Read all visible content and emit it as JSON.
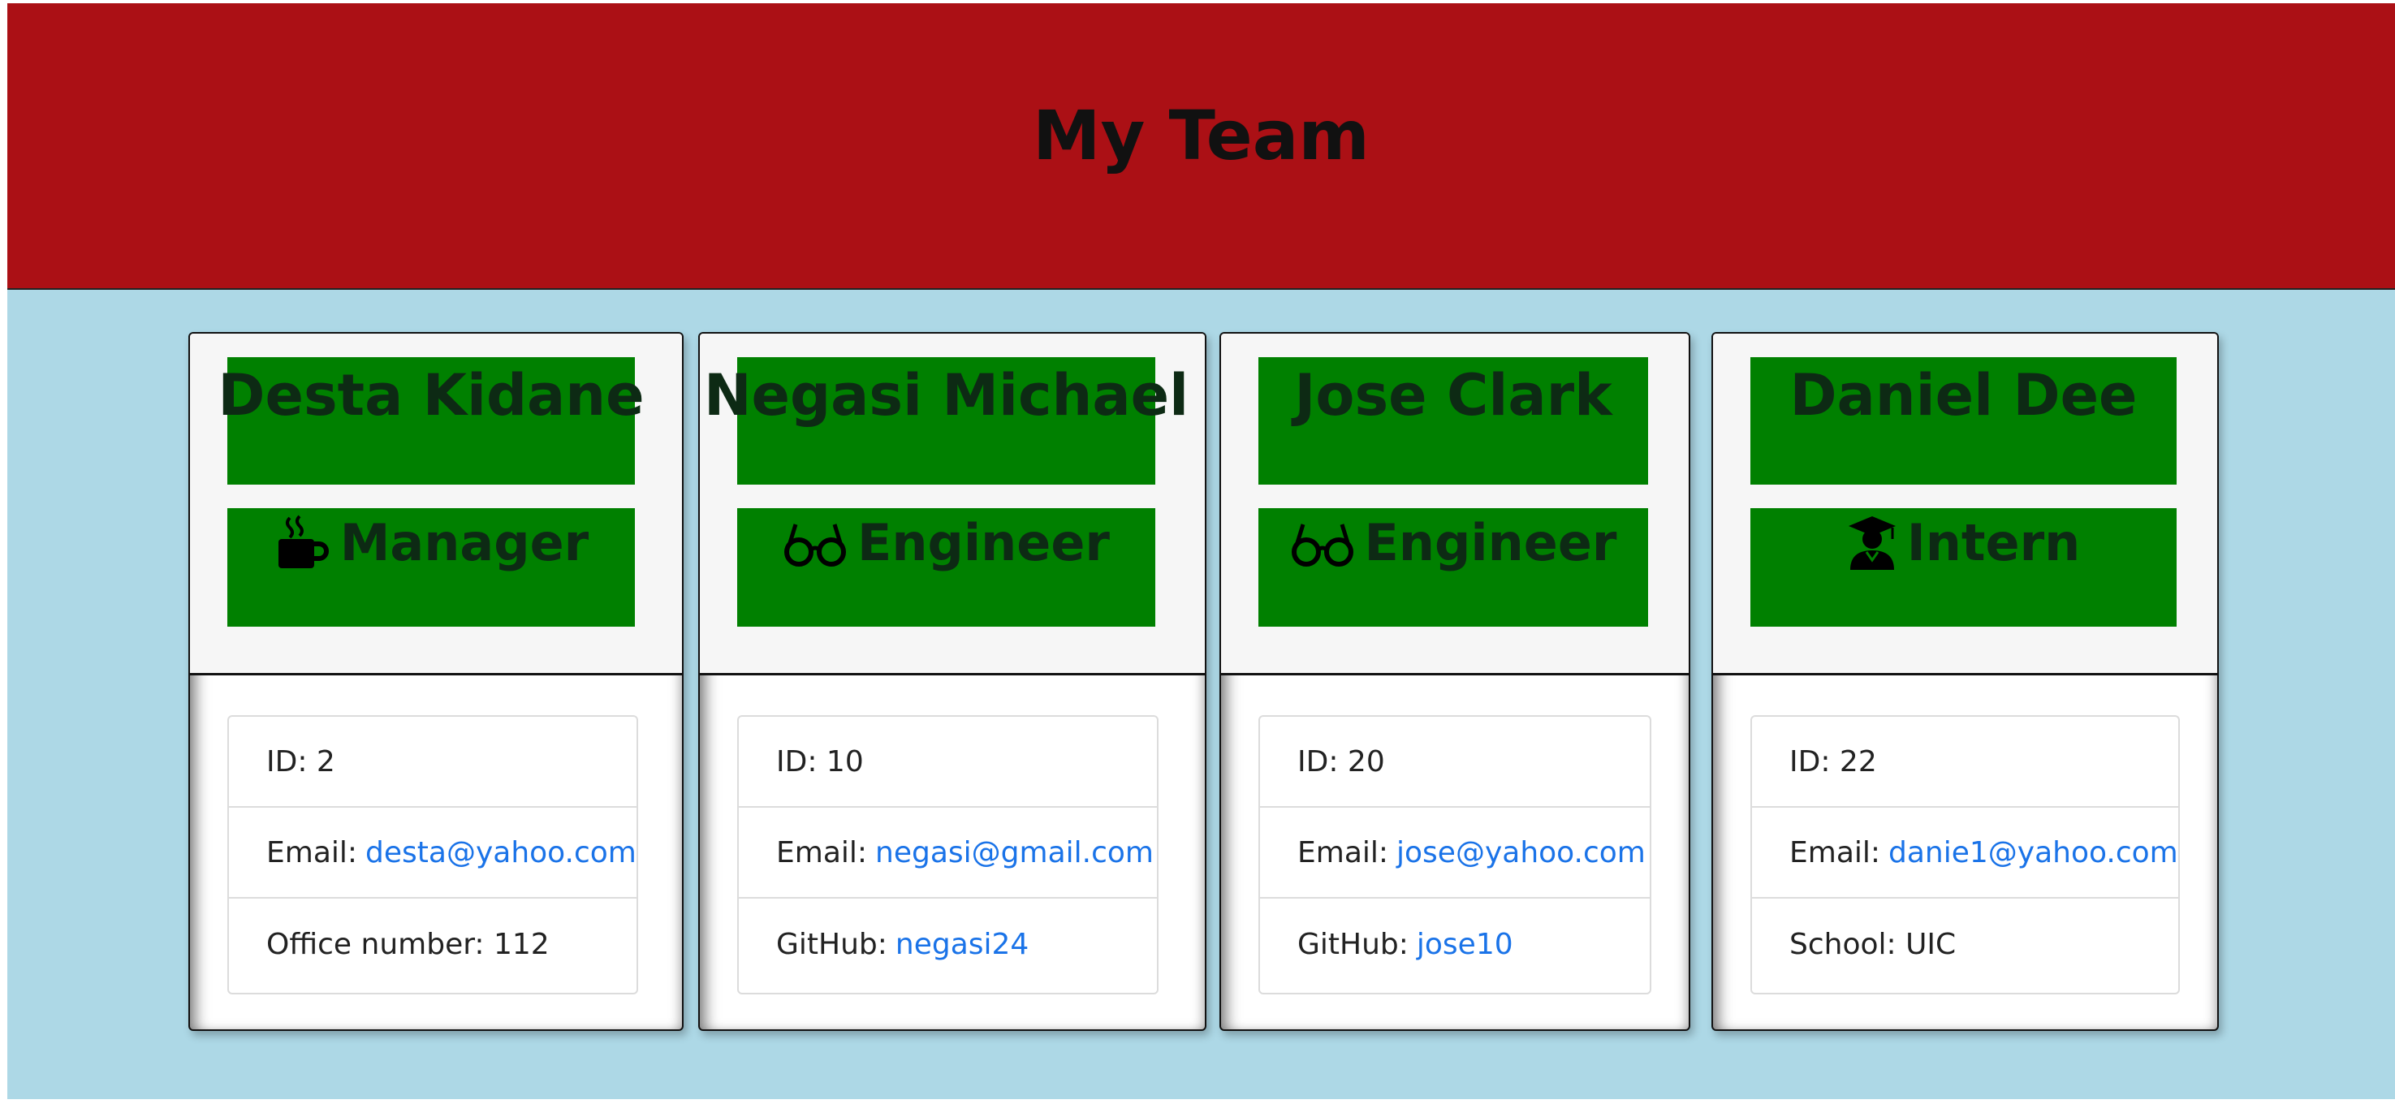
{
  "header": {
    "title": "My Team"
  },
  "colors": {
    "header_bg": "#ab1015",
    "page_bg": "#add8e6",
    "card_header_bg": "#008000",
    "link": "#1a73e8"
  },
  "cards": [
    {
      "name": "Desta Kidane",
      "role": "Manager",
      "role_icon": "coffee-mug-icon",
      "id_text": "ID: 2",
      "email_label": "Email:",
      "email": "desta@yahoo.com",
      "extra_label": "Office number: 112",
      "extra_link": ""
    },
    {
      "name": "Negasi Michael",
      "role": "Engineer",
      "role_icon": "glasses-icon",
      "id_text": "ID: 10",
      "email_label": "Email:",
      "email": "negasi@gmail.com",
      "extra_label": "GitHub:",
      "extra_link": "negasi24"
    },
    {
      "name": "Jose Clark",
      "role": "Engineer",
      "role_icon": "glasses-icon",
      "id_text": "ID: 20",
      "email_label": "Email:",
      "email": "jose@yahoo.com",
      "extra_label": "GitHub:",
      "extra_link": "jose10"
    },
    {
      "name": "Daniel Dee",
      "role": "Intern",
      "role_icon": "graduate-icon",
      "id_text": "ID: 22",
      "email_label": "Email:",
      "email": "danie1@yahoo.com",
      "extra_label": "School: UIC",
      "extra_link": ""
    }
  ]
}
